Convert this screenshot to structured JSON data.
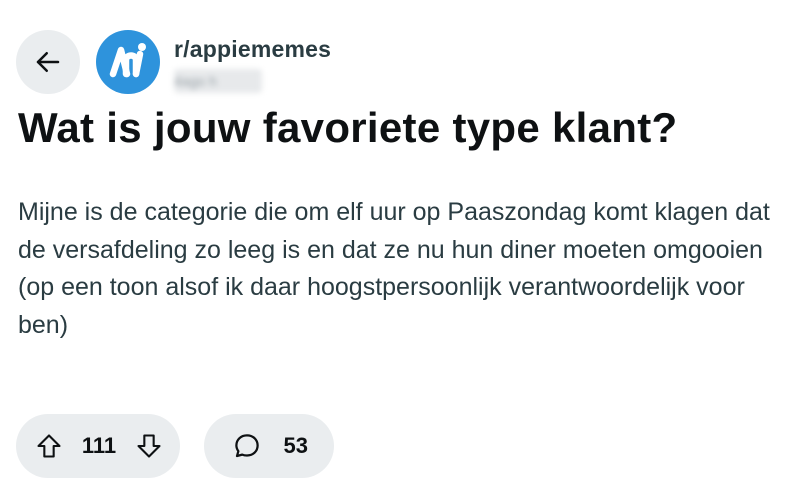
{
  "header": {
    "subreddit": "r/appiememes",
    "timestamp": "4ago h",
    "brand_color": "#2e93dc"
  },
  "post": {
    "title": "Wat is jouw favoriete type klant?",
    "body": "Mijne is de categorie die om elf uur op Paaszondag komt klagen dat de versafdeling zo leeg is en dat ze nu hun diner moeten omgooien (op een toon alsof ik daar hoogstpersoonlijk verantwoordelijk voor ben)"
  },
  "actions": {
    "vote_count": "111",
    "comment_count": "53"
  },
  "icons": {
    "back": "arrow-left-icon",
    "avatar": "ah-logo-icon",
    "upvote": "upvote-arrow-icon",
    "downvote": "downvote-arrow-icon",
    "comments": "comment-bubble-icon"
  },
  "colors": {
    "pill_background": "#eaedef",
    "text_primary": "#0e1113",
    "text_secondary": "#2a3c42"
  }
}
